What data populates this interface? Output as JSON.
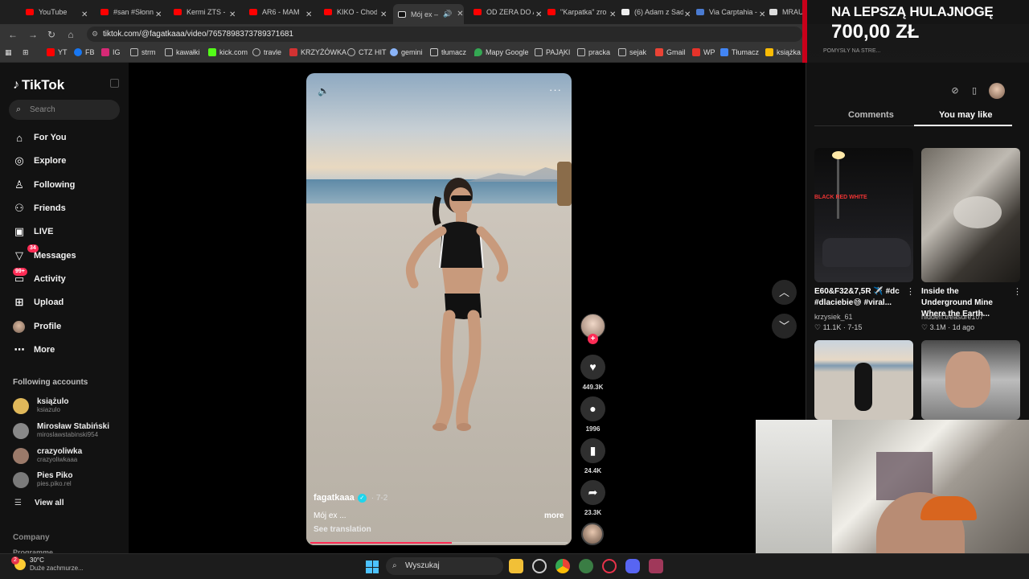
{
  "browser": {
    "tabs": [
      {
        "label": "YouTube",
        "icon": "youtube-icon"
      },
      {
        "label": "#san #Słonn",
        "icon": "youtube-icon"
      },
      {
        "label": "Kermi ZTS - Y",
        "icon": "youtube-icon"
      },
      {
        "label": "AR6 - MAM I",
        "icon": "youtube-icon"
      },
      {
        "label": "KIKO - Chod",
        "icon": "youtube-icon"
      },
      {
        "label": "Mój ex –",
        "icon": "tiktok-icon",
        "active": true
      },
      {
        "label": "OD ZERA DO AU",
        "icon": "youtube-icon"
      },
      {
        "label": "\"Karpatka\" zrobi",
        "icon": "youtube-icon"
      },
      {
        "label": "(6) Adam z Sady",
        "icon": "x-icon"
      },
      {
        "label": "Via Carptahia - P",
        "icon": "viacarpathia-icon"
      },
      {
        "label": "MRAU!",
        "icon": "wp-icon"
      }
    ],
    "url": "tiktok.com/@fagatkaaa/video/7657898373789371681",
    "bookmarks": [
      {
        "label": "YT",
        "color": "#ff0000"
      },
      {
        "label": "FB",
        "color": "#1877f2"
      },
      {
        "label": "IG",
        "color": "#d62976"
      },
      {
        "label": "strm",
        "color": "#bbbbbb"
      },
      {
        "label": "kawałki",
        "color": "#bbbbbb"
      },
      {
        "label": "kick.com",
        "color": "#53fc18"
      },
      {
        "label": "travle",
        "color": "#bbbbbb"
      },
      {
        "label": "KRZYŻÓWKA",
        "color": "#d23232"
      },
      {
        "label": "CTZ HIT",
        "color": "#bbbbbb"
      },
      {
        "label": "gemini",
        "color": "#8ab4f8"
      },
      {
        "label": "tłumacz",
        "color": "#cccccc"
      },
      {
        "label": "Mapy Google",
        "color": "#34a853"
      },
      {
        "label": "PAJĄKI",
        "color": "#bbbbbb"
      },
      {
        "label": "pracka",
        "color": "#bbbbbb"
      },
      {
        "label": "sejak",
        "color": "#bbbbbb"
      },
      {
        "label": "Gmail",
        "color": "#ea4335"
      },
      {
        "label": "WP",
        "color": "#e6332a"
      },
      {
        "label": "Tłumacz",
        "color": "#4285f4"
      },
      {
        "label": "książka",
        "color": "#fbbc05"
      }
    ]
  },
  "overlay": {
    "line1": "NA LEPSZĄ HULAJNOGĘ",
    "line2": "700,00 ZŁ",
    "line3": "POMYSŁY NA STRE..."
  },
  "tiktok": {
    "logo": "TikTok",
    "search_placeholder": "Search",
    "nav": [
      {
        "label": "For You",
        "icon": "home-icon"
      },
      {
        "label": "Explore",
        "icon": "compass-icon"
      },
      {
        "label": "Following",
        "icon": "following-icon"
      },
      {
        "label": "Friends",
        "icon": "friends-icon"
      },
      {
        "label": "LIVE",
        "icon": "live-icon"
      },
      {
        "label": "Messages",
        "icon": "messages-icon",
        "badge": "34"
      },
      {
        "label": "Activity",
        "icon": "activity-icon",
        "badge": "99+"
      },
      {
        "label": "Upload",
        "icon": "upload-icon"
      },
      {
        "label": "Profile",
        "icon": "profile-avatar"
      },
      {
        "label": "More",
        "icon": "more-icon"
      }
    ],
    "following_header": "Following accounts",
    "following": [
      {
        "name": "książulo",
        "handle": "ksiazulo",
        "color": "#e0b85a"
      },
      {
        "name": "Mirosław Stabiński",
        "handle": "miroslawstabinski954",
        "color": "#888888"
      },
      {
        "name": "crazyoliwka",
        "handle": "crazyoliwkaaa",
        "color": "#9b7a6a"
      },
      {
        "name": "Pies Piko",
        "handle": "pies.piko.rel",
        "color": "#7a7a7a"
      }
    ],
    "view_all": "View all",
    "footer": [
      "Company",
      "Programme"
    ]
  },
  "video": {
    "author": "fagatkaaa",
    "date": "· 7-2",
    "caption": "Mój ex ...",
    "more": "more",
    "translation": "See translation",
    "progress": 0.55,
    "likes": "449.3K",
    "comments": "1996",
    "saves": "24.4K",
    "shares": "23.3K"
  },
  "panel": {
    "tab_comments": "Comments",
    "tab_like": "You may like",
    "cards": [
      {
        "title": "E60&F32&7,5R ✈️ #dc #dlaciebie😅 #viral...",
        "author": "krzysiek_61",
        "stats": "♡ 11.1K · 7-15",
        "thumb_text": "BLACK RED WHITE"
      },
      {
        "title": "Inside the Underground Mine Where the Earth...",
        "author": "hidden.treasure107",
        "stats": "♡ 3.1M · 1d ago"
      }
    ]
  },
  "taskbar": {
    "weather_temp": "30°C",
    "weather_desc": "Duże zachmurze...",
    "weather_badge": "2",
    "search": "Wyszukaj"
  }
}
